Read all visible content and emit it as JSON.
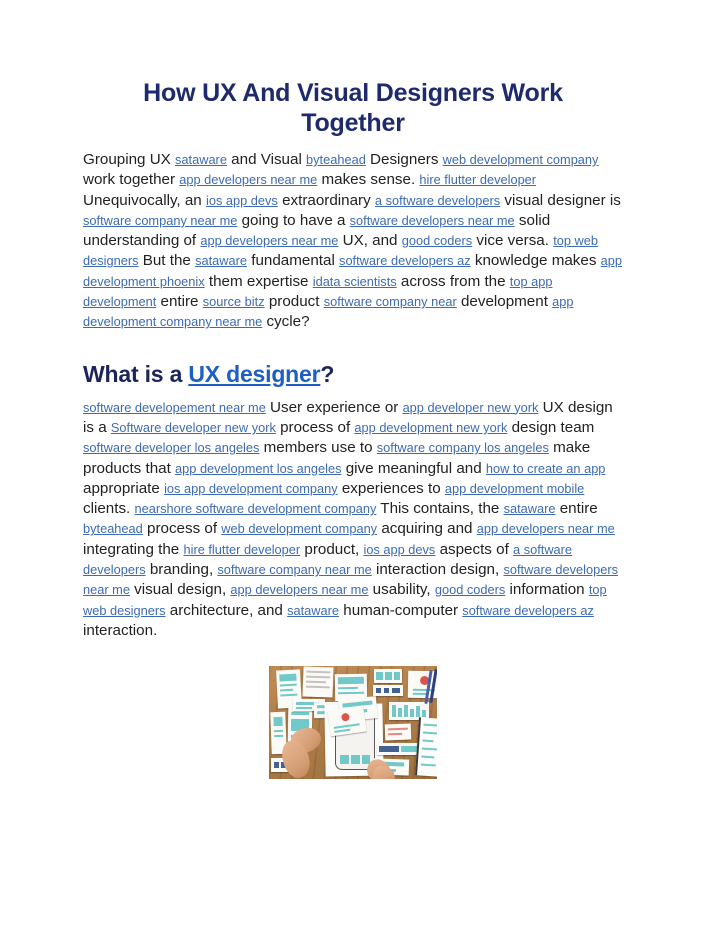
{
  "document": {
    "title": "How UX And Visual Designers Work Together",
    "section_heading": {
      "before": "What is a ",
      "link": "UX designer",
      "after": "?"
    }
  },
  "colors": {
    "title": "#1e2a6b",
    "body_text": "#222222",
    "link": "#3d6bb3",
    "heading_link": "#1f5fc4",
    "background": "#ffffff"
  },
  "paragraph1": [
    {
      "type": "text",
      "value": "Grouping UX "
    },
    {
      "type": "link",
      "value": "sataware"
    },
    {
      "type": "text",
      "value": " and Visual "
    },
    {
      "type": "link",
      "value": "byteahead"
    },
    {
      "type": "text",
      "value": " Designers "
    },
    {
      "type": "link",
      "value": "web development company"
    },
    {
      "type": "text",
      "value": " work together "
    },
    {
      "type": "link",
      "value": "app developers near me"
    },
    {
      "type": "text",
      "value": " makes sense. "
    },
    {
      "type": "link",
      "value": "hire flutter developer"
    },
    {
      "type": "text",
      "value": " Unequivocally, an "
    },
    {
      "type": "link",
      "value": "ios app devs"
    },
    {
      "type": "text",
      "value": " extraordinary "
    },
    {
      "type": "link",
      "value": "a software developers"
    },
    {
      "type": "text",
      "value": " visual designer is "
    },
    {
      "type": "link",
      "value": "software company near me"
    },
    {
      "type": "text",
      "value": " going to have a "
    },
    {
      "type": "link",
      "value": "software developers near me"
    },
    {
      "type": "text",
      "value": " solid understanding of "
    },
    {
      "type": "link",
      "value": "app developers near me"
    },
    {
      "type": "text",
      "value": " UX, and "
    },
    {
      "type": "link",
      "value": "good coders"
    },
    {
      "type": "text",
      "value": " vice versa. "
    },
    {
      "type": "link",
      "value": "top web designers"
    },
    {
      "type": "text",
      "value": " But the "
    },
    {
      "type": "link",
      "value": "sataware"
    },
    {
      "type": "text",
      "value": " fundamental "
    },
    {
      "type": "link",
      "value": "software developers az"
    },
    {
      "type": "text",
      "value": " knowledge makes "
    },
    {
      "type": "link",
      "value": "app development phoenix"
    },
    {
      "type": "text",
      "value": " them expertise "
    },
    {
      "type": "link",
      "value": "idata scientists"
    },
    {
      "type": "text",
      "value": " across from the "
    },
    {
      "type": "link",
      "value": "top app development"
    },
    {
      "type": "text",
      "value": " entire "
    },
    {
      "type": "link",
      "value": "source bitz"
    },
    {
      "type": "text",
      "value": " product "
    },
    {
      "type": "link",
      "value": "software company near"
    },
    {
      "type": "text",
      "value": " development "
    },
    {
      "type": "link",
      "value": "app development company near me"
    },
    {
      "type": "text",
      "value": " cycle?"
    }
  ],
  "paragraph2": [
    {
      "type": "link",
      "value": "software developement near me"
    },
    {
      "type": "text",
      "value": " User experience or "
    },
    {
      "type": "link",
      "value": "app developer new york"
    },
    {
      "type": "text",
      "value": " UX design is a "
    },
    {
      "type": "link",
      "value": "Software developer new york"
    },
    {
      "type": "text",
      "value": " process of "
    },
    {
      "type": "link",
      "value": "app development new york"
    },
    {
      "type": "text",
      "value": " design team "
    },
    {
      "type": "link",
      "value": "software developer los angeles"
    },
    {
      "type": "text",
      "value": " members use to "
    },
    {
      "type": "link",
      "value": "software company los angeles"
    },
    {
      "type": "text",
      "value": " make products that "
    },
    {
      "type": "link",
      "value": "app development los angeles"
    },
    {
      "type": "text",
      "value": " give meaningful and "
    },
    {
      "type": "link",
      "value": "how to create an app"
    },
    {
      "type": "text",
      "value": " appropriate "
    },
    {
      "type": "link",
      "value": "ios app development company"
    },
    {
      "type": "text",
      "value": " experiences to "
    },
    {
      "type": "link",
      "value": "app development mobile"
    },
    {
      "type": "text",
      "value": " clients. "
    },
    {
      "type": "link",
      "value": "nearshore software development company"
    },
    {
      "type": "text",
      "value": " This contains, the "
    },
    {
      "type": "link",
      "value": "sataware"
    },
    {
      "type": "text",
      "value": " entire "
    },
    {
      "type": "link",
      "value": "byteahead"
    },
    {
      "type": "text",
      "value": " process of "
    },
    {
      "type": "link",
      "value": "web development company"
    },
    {
      "type": "text",
      "value": " acquiring and "
    },
    {
      "type": "link",
      "value": "app developers near me"
    },
    {
      "type": "text",
      "value": " integrating the "
    },
    {
      "type": "link",
      "value": "hire flutter developer"
    },
    {
      "type": "text",
      "value": " product, "
    },
    {
      "type": "link",
      "value": "ios app devs"
    },
    {
      "type": "text",
      "value": " aspects of "
    },
    {
      "type": "link",
      "value": "a software developers"
    },
    {
      "type": "text",
      "value": " branding, "
    },
    {
      "type": "link",
      "value": "software company near me"
    },
    {
      "type": "text",
      "value": " interaction design, "
    },
    {
      "type": "link",
      "value": "software developers near me"
    },
    {
      "type": "text",
      "value": " visual design, "
    },
    {
      "type": "link",
      "value": "app developers near me"
    },
    {
      "type": "text",
      "value": " usability, "
    },
    {
      "type": "link",
      "value": "good coders"
    },
    {
      "type": "text",
      "value": " information "
    },
    {
      "type": "link",
      "value": "top web designers"
    },
    {
      "type": "text",
      "value": " architecture, and "
    },
    {
      "type": "link",
      "value": "sataware"
    },
    {
      "type": "text",
      "value": " human-computer "
    },
    {
      "type": "link",
      "value": "software developers az"
    },
    {
      "type": "text",
      "value": " interaction."
    }
  ],
  "photo": {
    "alt": "UX wireframe paper prototypes spread on a wooden desk with hands arranging cards, a tablet, pencils and a notebook"
  }
}
